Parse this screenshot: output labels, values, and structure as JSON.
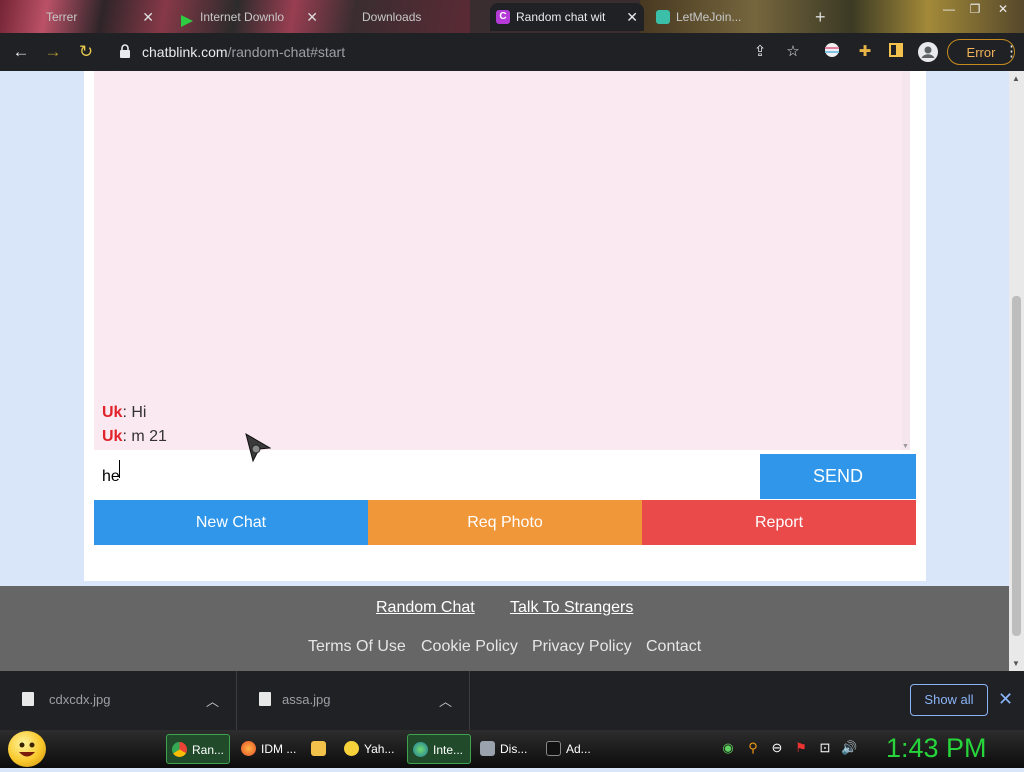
{
  "browser": {
    "tabs": [
      {
        "title": "Terrer"
      },
      {
        "title": "Internet Downlo"
      },
      {
        "title": "Downloads"
      },
      {
        "title": "Random chat wit",
        "active": true
      },
      {
        "title": "LetMeJoin..."
      }
    ],
    "url_domain": "chatblink.com",
    "url_path": "/random-chat#start",
    "error_label": "Error"
  },
  "chat": {
    "messages": [
      {
        "sender": "Uk",
        "text": ": Hi"
      },
      {
        "sender": "Uk",
        "text": ": m 21"
      }
    ],
    "input_value": "he",
    "send_label": "SEND"
  },
  "actions": {
    "new_chat": "New Chat",
    "req_photo": "Req Photo",
    "report": "Report"
  },
  "footer": {
    "link1": "Random Chat",
    "link2": "Talk To Strangers",
    "terms": "Terms Of Use",
    "cookie": "Cookie Policy",
    "privacy": "Privacy Policy",
    "contact": "Contact"
  },
  "downloads": {
    "items": [
      {
        "name": "cdxcdx.jpg"
      },
      {
        "name": "assa.jpg"
      }
    ],
    "show_all": "Show all"
  },
  "taskbar": {
    "items": [
      {
        "label": "Ran..."
      },
      {
        "label": "IDM ..."
      },
      {
        "label": ""
      },
      {
        "label": "Yah..."
      },
      {
        "label": "Inte..."
      },
      {
        "label": "Dis..."
      },
      {
        "label": "Ad..."
      }
    ],
    "clock": "1:43 PM"
  },
  "colors": {
    "send": "#2f96ea",
    "new_chat": "#2f96ea",
    "req_photo": "#f0973a",
    "report": "#ea4a4a",
    "sender": "#e0232a",
    "footer_bg": "#666666",
    "clock": "#27d43a"
  }
}
